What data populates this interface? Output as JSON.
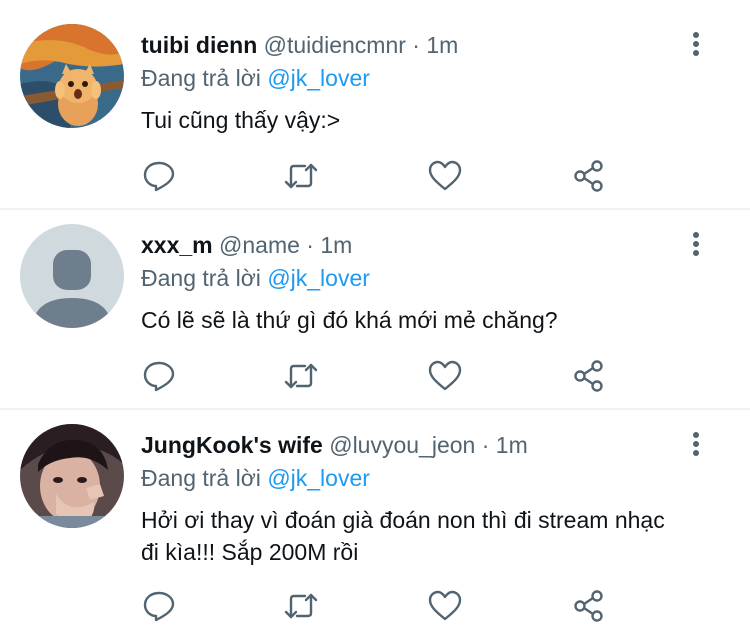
{
  "tweets": [
    {
      "name": "tuibi dienn",
      "handle": "@tuidiencmnr",
      "separator": "·",
      "time": "1m",
      "reply_prefix": "Đang trả lời",
      "reply_to": "@jk_lover",
      "text": "Tui cũng thấy vậy:>",
      "avatar": "scream-cat-avatar"
    },
    {
      "name": "xxx_m",
      "handle": "@name",
      "separator": "·",
      "time": "1m",
      "reply_prefix": "Đang trả lời",
      "reply_to": "@jk_lover",
      "text": "Có lẽ sẽ là thứ gì đó khá mới mẻ chăng?",
      "avatar": "default-avatar"
    },
    {
      "name": "JungKook's wife",
      "handle": "@luvyou_jeon",
      "separator": "·",
      "time": "1m",
      "reply_prefix": "Đang trả lời",
      "reply_to": "@jk_lover",
      "text": "Hởi ơi thay vì đoán già đoán non thì đi stream nhạc đi kìa!!! Sắp 200M rồi",
      "avatar": "photo-avatar"
    }
  ],
  "icons": {
    "reply": "reply-icon",
    "retweet": "retweet-icon",
    "like": "heart-icon",
    "share": "share-icon",
    "more": "more-vertical-icon"
  },
  "colors": {
    "text": "#0f1419",
    "secondary": "#536471",
    "mention": "#1d9bf0",
    "divider": "#eff3f4"
  }
}
